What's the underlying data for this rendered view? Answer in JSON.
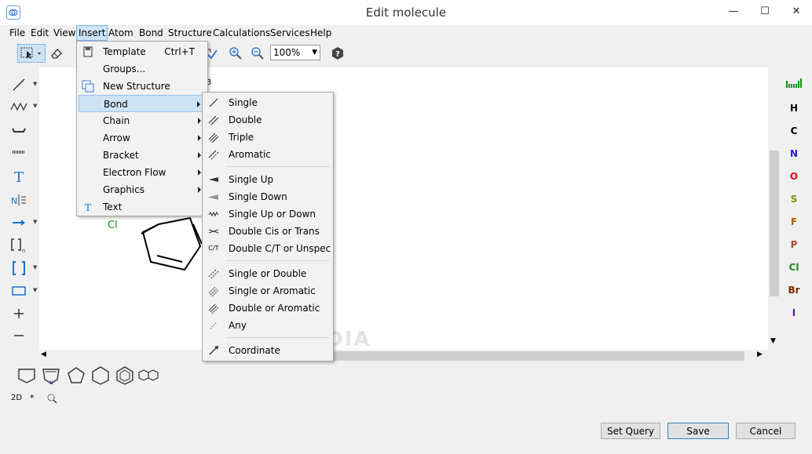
{
  "window": {
    "title": "Edit molecule",
    "minimize": "—",
    "maximize": "☐",
    "close": "✕"
  },
  "menubar": [
    "File",
    "Edit",
    "View",
    "Insert",
    "Atom",
    "Bond",
    "Structure",
    "Calculations",
    "Services",
    "Help"
  ],
  "toolbar": {
    "zoom": "100%"
  },
  "canvas": {
    "label_cl": "Cl",
    "label_subscript": "3"
  },
  "atoms": [
    "H",
    "C",
    "N",
    "O",
    "S",
    "F",
    "P",
    "Cl",
    "Br",
    "I"
  ],
  "atom_colors": {
    "H": "#000000",
    "C": "#000000",
    "N": "#1f1fcf",
    "O": "#e00000",
    "S": "#8a8a00",
    "F": "#b06000",
    "P": "#a0522d",
    "Cl": "#1a8f1a",
    "Br": "#7a2a00",
    "I": "#6a1b9a"
  },
  "bottom": {
    "mode_2d": "2D",
    "star": "*"
  },
  "insert_menu": [
    {
      "label": "Template",
      "shortcut": "Ctrl+T",
      "icon": "template-icon"
    },
    {
      "label": "Groups...",
      "shortcut": "",
      "icon": ""
    },
    {
      "label": "New Structure",
      "shortcut": "",
      "icon": "new-structure-icon"
    },
    {
      "label": "Bond",
      "shortcut": "",
      "icon": "",
      "submenu": true,
      "highlighted": true
    },
    {
      "label": "Chain",
      "shortcut": "",
      "icon": "",
      "submenu": true
    },
    {
      "label": "Arrow",
      "shortcut": "",
      "icon": "",
      "submenu": true
    },
    {
      "label": "Bracket",
      "shortcut": "",
      "icon": "",
      "submenu": true
    },
    {
      "label": "Electron Flow",
      "shortcut": "",
      "icon": "",
      "submenu": true
    },
    {
      "label": "Graphics",
      "shortcut": "",
      "icon": "",
      "submenu": true
    },
    {
      "label": "Text",
      "shortcut": "",
      "icon": "text-icon"
    }
  ],
  "bond_menu": {
    "group1": [
      "Single",
      "Double",
      "Triple",
      "Aromatic"
    ],
    "group2": [
      "Single Up",
      "Single Down",
      "Single Up or Down",
      "Double Cis or Trans",
      "Double C/T or Unspec"
    ],
    "group3": [
      "Single or Double",
      "Single or Aromatic",
      "Double or Aromatic",
      "Any"
    ],
    "group4": [
      "Coordinate"
    ],
    "ct_icon_text": "C/T"
  },
  "buttons": {
    "set_query": "Set Query",
    "save": "Save",
    "cancel": "Cancel"
  },
  "watermark": "SOFTPEDIA"
}
